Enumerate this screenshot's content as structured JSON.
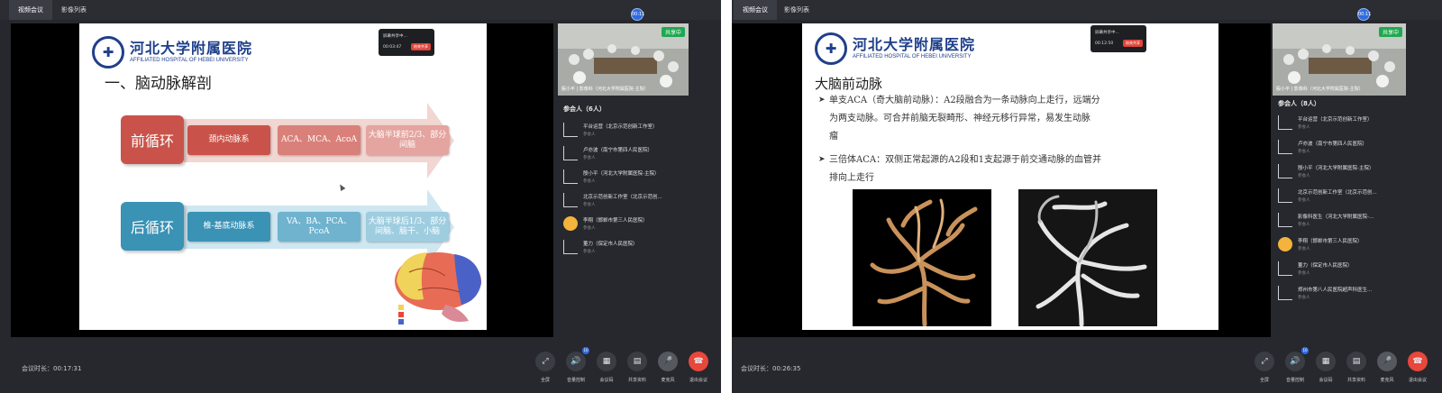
{
  "tabs": [
    "视频会议",
    "影像列表"
  ],
  "top_badge": "00:11",
  "left": {
    "slide": {
      "logo_cn": "河北大学附属医院",
      "logo_en": "AFFILIATED HOSPITAL OF HEBEI UNIVERSITY",
      "title": "一、脑动脉解剖",
      "rows": [
        {
          "head": "前循环",
          "boxes": [
            "颈内动脉系",
            "ACA、MCA、AcoA",
            "大脑半球前2/3、部分间脑"
          ]
        },
        {
          "head": "后循环",
          "boxes": [
            "椎-基底动脉系",
            "VA、BA、PCA、PcoA",
            "大脑半球后1/3、部分间脑、脑干、小脑"
          ]
        }
      ]
    },
    "share_popup": {
      "title": "屏幕共享中...",
      "time": "00:03:47",
      "stop": "结束共享"
    },
    "video": {
      "live": "共享中",
      "caption": "殷小平 | 影像科（河北大学附属医院-主院）"
    },
    "participants_title": "参会人（6人）",
    "participants": [
      {
        "name": "平台运营（北京示范创新工作室）",
        "role": "参会人"
      },
      {
        "name": "卢亦波（南宁市第四人民医院）",
        "role": "参会人"
      },
      {
        "name": "殷小平（河北大学附属医院-主院）",
        "role": "参会人"
      },
      {
        "name": "北京示范创新工作室（北京示范创...",
        "role": "参会人"
      },
      {
        "name": "李翔（邯郸市第三人民医院）",
        "role": "参会人"
      },
      {
        "name": "董力（保定市人民医院）",
        "role": "参会人"
      }
    ],
    "duration": "会议时长：00:17:31"
  },
  "right": {
    "slide": {
      "logo_cn": "河北大学附属医院",
      "logo_en": "AFFILIATED HOSPITAL OF HEBEI UNIVERSITY",
      "title": "大脑前动脉",
      "bullet1_l1": "单支ACA（奇大脑前动脉）：A2段融合为一条动脉向上走行，远端分",
      "bullet1_l2": "为两支动脉。可合并前脑无裂畸形、神经元移行异常，易发生动脉",
      "bullet1_l3": "瘤",
      "bullet2_l1": "三倍体ACA：双侧正常起源的A2段和1支起源于前交通动脉的血管并",
      "bullet2_l2": "排向上走行"
    },
    "share_popup": {
      "title": "屏幕共享中...",
      "time": "00:12:50",
      "stop": "结束共享"
    },
    "video": {
      "live": "共享中",
      "caption": "殷小平 | 影像科（河北大学附属医院-主院）"
    },
    "participants_title": "参会人（8人）",
    "participants": [
      {
        "name": "平台运营（北京示范创新工作室）",
        "role": "参会人"
      },
      {
        "name": "卢亦波（南宁市第四人民医院）",
        "role": "参会人"
      },
      {
        "name": "殷小平（河北大学附属医院-主院）",
        "role": "参会人"
      },
      {
        "name": "北京示范创新工作室（北京示范创...",
        "role": "参会人"
      },
      {
        "name": "影像科医生（河北大学附属医院-...",
        "role": "参会人"
      },
      {
        "name": "李翔（邯郸市第三人民医院）",
        "role": "参会人"
      },
      {
        "name": "董力（保定市人民医院）",
        "role": "参会人"
      },
      {
        "name": "郑州市第八人民医院超声科医生...",
        "role": "参会人"
      }
    ],
    "duration": "会议时长：00:26:35"
  },
  "controls": [
    "全屏",
    "音量控制",
    "会议码",
    "共享资料",
    "麦克风",
    "退出会议"
  ],
  "volume_badge": "10",
  "icons": [
    "fullscreen-icon",
    "speaker-icon",
    "qrcode-icon",
    "document-icon",
    "microphone-icon",
    "hangup-icon"
  ],
  "colors": {
    "front_circ": "#c9534a",
    "back_circ": "#3a92b5",
    "live": "#1fa84f",
    "hangup": "#e8473c",
    "brand_blue": "#1f3f8a"
  }
}
